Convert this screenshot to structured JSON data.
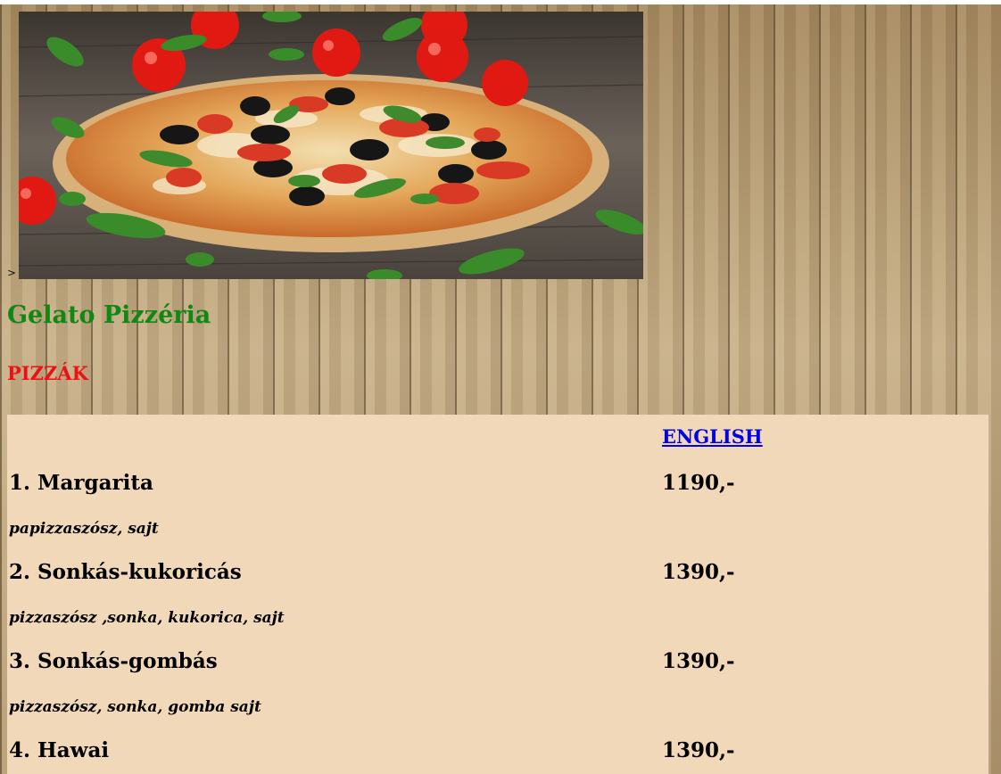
{
  "page": {
    "stray_text": ">"
  },
  "header": {
    "site_title": "Gelato Pizzéria",
    "section_title": "PIZZÁK"
  },
  "menu": {
    "language_link": "ENGLISH",
    "items": [
      {
        "name": "1. Margarita",
        "price": "1190,-",
        "description": "papizzaszósz, sajt"
      },
      {
        "name": "2. Sonkás-kukoricás",
        "price": "1390,-",
        "description": "pizzaszósz ,sonka, kukorica, sajt"
      },
      {
        "name": "3. Sonkás-gombás",
        "price": "1390,-",
        "description": "pizzaszósz, sonka, gomba sajt"
      },
      {
        "name": "4. Hawai",
        "price": "1390,-",
        "description": ""
      }
    ]
  },
  "colors": {
    "site_title": "#118811",
    "section_title": "#ee1111",
    "menu_panel": "#f1d8b8",
    "link": "#0000ee"
  }
}
